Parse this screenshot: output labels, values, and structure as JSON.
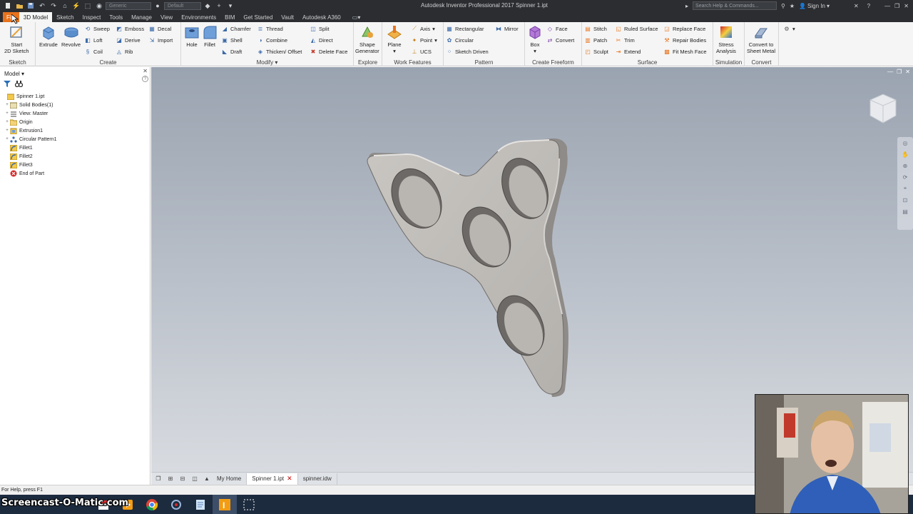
{
  "titlebar": {
    "title": "Autodesk Inventor Professional 2017   Spinner 1.ipt",
    "appearance_combo": "Generic",
    "material_combo": "Default",
    "search_placeholder": "Search Help & Commands...",
    "sign_in": "Sign In"
  },
  "tabs": [
    "File",
    "3D Model",
    "Sketch",
    "Inspect",
    "Tools",
    "Manage",
    "View",
    "Environments",
    "BIM",
    "Get Started",
    "Vault",
    "Autodesk A360"
  ],
  "ribbon": {
    "sketch": {
      "label": "Sketch",
      "start": "Start",
      "start2": "2D Sketch"
    },
    "create": {
      "label": "Create",
      "extrude": "Extrude",
      "revolve": "Revolve",
      "sweep": "Sweep",
      "loft": "Loft",
      "coil": "Coil",
      "emboss": "Emboss",
      "derive": "Derive",
      "rib": "Rib",
      "decal": "Decal",
      "import": "Import"
    },
    "modify": {
      "label": "Modify",
      "hole": "Hole",
      "fillet": "Fillet",
      "chamfer": "Chamfer",
      "shell": "Shell",
      "draft": "Draft",
      "thread": "Thread",
      "combine": "Combine",
      "thicken": "Thicken/ Offset",
      "split": "Split",
      "direct": "Direct",
      "delete_face": "Delete Face"
    },
    "explore": {
      "label": "Explore",
      "shape1": "Shape",
      "shape2": "Generator"
    },
    "work": {
      "label": "Work Features",
      "plane": "Plane",
      "axis": "Axis",
      "point": "Point",
      "ucs": "UCS"
    },
    "pattern": {
      "label": "Pattern",
      "rectangular": "Rectangular",
      "circular": "Circular",
      "sketch_driven": "Sketch Driven",
      "mirror": "Mirror"
    },
    "freeform": {
      "label": "Create Freeform",
      "box": "Box",
      "face": "Face",
      "convert": "Convert"
    },
    "surface": {
      "label": "Surface",
      "stitch": "Stitch",
      "patch": "Patch",
      "sculpt": "Sculpt",
      "ruled": "Ruled Surface",
      "trim": "Trim",
      "extend": "Extend",
      "replace": "Replace Face",
      "repair": "Repair Bodies",
      "fitmesh": "Fit Mesh Face"
    },
    "simulation": {
      "label": "Simulation",
      "stress1": "Stress",
      "stress2": "Analysis"
    },
    "convert": {
      "label": "Convert",
      "c1": "Convert to",
      "c2": "Sheet Metal"
    }
  },
  "browser": {
    "title": "Model",
    "items": [
      {
        "label": "Spinner 1.ipt",
        "icon": "part-icon",
        "expander": ""
      },
      {
        "label": "Solid Bodies(1)",
        "icon": "solid-bodies-icon",
        "expander": "+"
      },
      {
        "label": "View: Master",
        "icon": "view-icon",
        "expander": "+"
      },
      {
        "label": "Origin",
        "icon": "folder-icon",
        "expander": "+"
      },
      {
        "label": "Extrusion1",
        "icon": "extrusion-icon",
        "expander": "+"
      },
      {
        "label": "Circular Pattern1",
        "icon": "circular-pattern-icon",
        "expander": "+"
      },
      {
        "label": "Fillet1",
        "icon": "fillet-icon",
        "expander": ""
      },
      {
        "label": "Fillet2",
        "icon": "fillet-icon",
        "expander": ""
      },
      {
        "label": "Fillet3",
        "icon": "fillet-icon",
        "expander": ""
      },
      {
        "label": "End of Part",
        "icon": "end-of-part-icon",
        "expander": ""
      }
    ]
  },
  "doctabs": {
    "home": "My Home",
    "active": "Spinner 1.ipt",
    "other": "spinner.idw"
  },
  "status": "For Help, press F1",
  "watermark": "Screencast-O-Matic.com",
  "colors": {
    "accent": "#e8731c",
    "titlebar": "#2b2d31",
    "taskbar": "#1d2b3f"
  }
}
